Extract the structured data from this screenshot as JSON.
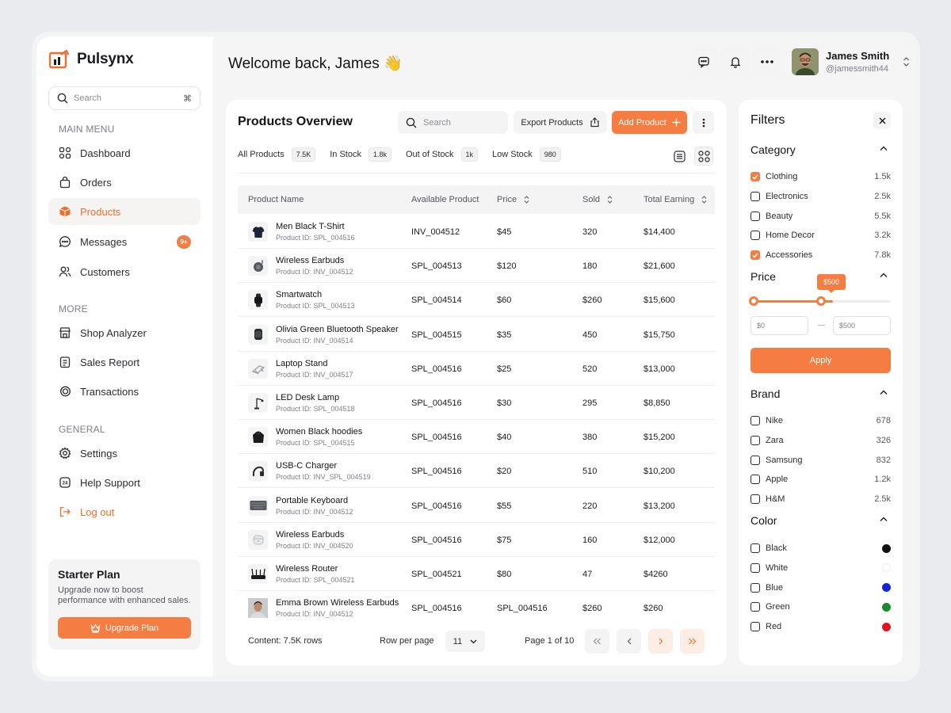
{
  "brand": {
    "name": "Pulsynx"
  },
  "sidebar": {
    "search_placeholder": "Search",
    "search_shortcut": "⌘",
    "main_menu_title": "MAIN MENU",
    "main_items": [
      {
        "label": "Dashboard",
        "icon": "dashboard-icon"
      },
      {
        "label": "Orders",
        "icon": "bag-icon"
      },
      {
        "label": "Products",
        "icon": "box-icon",
        "active": true
      },
      {
        "label": "Messages",
        "icon": "chat-icon",
        "badge": "9+"
      },
      {
        "label": "Customers",
        "icon": "users-icon"
      }
    ],
    "more_title": "MORE",
    "more_items": [
      {
        "label": "Shop Analyzer",
        "icon": "shop-icon"
      },
      {
        "label": "Sales Report",
        "icon": "report-icon"
      },
      {
        "label": "Transactions",
        "icon": "coins-icon"
      }
    ],
    "general_title": "GENERAL",
    "general_items": [
      {
        "label": "Settings",
        "icon": "gear-icon"
      },
      {
        "label": "Help Support",
        "icon": "support-icon"
      },
      {
        "label": "Log out",
        "icon": "logout-icon"
      }
    ],
    "plan": {
      "title": "Starter Plan",
      "description": "Upgrade now to boost performance with enhanced sales.",
      "button": "Upgrade Plan"
    }
  },
  "header": {
    "welcome": "Welcome back, James 👋",
    "user": {
      "name": "James Smith",
      "handle": "@jamessmith44"
    }
  },
  "products": {
    "title": "Products Overview",
    "search_placeholder": "Search",
    "export_label": "Export Products",
    "add_label": "Add Product",
    "tabs": [
      {
        "label": "All Products",
        "count": "7.5K"
      },
      {
        "label": "In Stock",
        "count": "1.8k"
      },
      {
        "label": "Out of Stock",
        "count": "1k"
      },
      {
        "label": "Low Stock",
        "count": "980"
      }
    ],
    "columns": [
      "Product Name",
      "Available Product",
      "Price",
      "Sold",
      "Total Earning"
    ],
    "rows": [
      {
        "name": "Men Black T-Shirt",
        "pid": "Product ID: SPL_004516",
        "available": "INV_004512",
        "price": "$45",
        "sold": "320",
        "earning": "$14,400",
        "thumb": "tshirt"
      },
      {
        "name": "Wireless Earbuds",
        "pid": "Product ID: INV_004512",
        "available": "SPL_004513",
        "price": "$120",
        "sold": "180",
        "earning": "$21,600",
        "thumb": "earbuds-round"
      },
      {
        "name": "Smartwatch",
        "pid": "Product ID: SPL_004513",
        "available": "SPL_004514",
        "price": "$60",
        "sold": "$260",
        "earning": "$15,600",
        "thumb": "watch"
      },
      {
        "name": "Olivia Green Bluetooth Speaker",
        "pid": "Product ID: INV_004514",
        "available": "SPL_004515",
        "price": "$35",
        "sold": "450",
        "earning": "$15,750",
        "thumb": "speaker"
      },
      {
        "name": "Laptop Stand",
        "pid": "Product ID: INV_004517",
        "available": "SPL_004516",
        "price": "$25",
        "sold": "520",
        "earning": "$13,000",
        "thumb": "stand"
      },
      {
        "name": "LED Desk Lamp",
        "pid": "Product ID: SPL_004518",
        "available": "SPL_004516",
        "price": "$30",
        "sold": "295",
        "earning": "$8,850",
        "thumb": "lamp"
      },
      {
        "name": "Women Black hoodies",
        "pid": "Product ID: SPL_004515",
        "available": "SPL_004516",
        "price": "$40",
        "sold": "380",
        "earning": "$15,200",
        "thumb": "hoodie"
      },
      {
        "name": "USB-C Charger",
        "pid": "Product ID: INV_SPL_004519",
        "available": "SPL_004516",
        "price": "$20",
        "sold": "510",
        "earning": "$10,200",
        "thumb": "charger"
      },
      {
        "name": "Portable Keyboard",
        "pid": "Product ID: INV_004512",
        "available": "SPL_004516",
        "price": "$55",
        "sold": "220",
        "earning": "$13,200",
        "thumb": "keyboard"
      },
      {
        "name": "Wireless Earbuds",
        "pid": "Product ID: INV_004520",
        "available": "SPL_004516",
        "price": "$75",
        "sold": "160",
        "earning": "$12,000",
        "thumb": "earbuds-case"
      },
      {
        "name": "Wireless Router",
        "pid": "Product ID: SPL_004521",
        "available": "SPL_004521",
        "price": "$80",
        "sold": "47",
        "earning": "$4260",
        "thumb": "router"
      },
      {
        "name": "Emma Brown Wireless Earbuds",
        "pid": "Product ID: INV_004512",
        "available": "SPL_004516",
        "price": "SPL_004516",
        "sold": "$260",
        "earning": "$260",
        "thumb": "person"
      }
    ],
    "footer": {
      "content": "Content: 7.5K rows",
      "rows_per_page_label": "Row per page",
      "rows_per_page_value": "11",
      "page_info": "Page 1 of 10"
    }
  },
  "filters": {
    "title": "Filters",
    "category_title": "Category",
    "categories": [
      {
        "label": "Clothing",
        "count": "1.5k",
        "checked": true
      },
      {
        "label": "Electronics",
        "count": "2.5k",
        "checked": false
      },
      {
        "label": "Beauty",
        "count": "5.5k",
        "checked": false
      },
      {
        "label": "Home Decor",
        "count": "3.2k",
        "checked": false
      },
      {
        "label": "Accessories",
        "count": "7.8k",
        "checked": true
      }
    ],
    "price_title": "Price",
    "price_tooltip": "$500",
    "price_min_placeholder": "$0",
    "price_max_placeholder": "$500",
    "apply_label": "Apply",
    "brand_title": "Brand",
    "brands": [
      {
        "label": "Nike",
        "count": "678"
      },
      {
        "label": "Zara",
        "count": "326"
      },
      {
        "label": "Samsung",
        "count": "832"
      },
      {
        "label": "Apple",
        "count": "1.2k"
      },
      {
        "label": "H&M",
        "count": "2.5k"
      }
    ],
    "color_title": "Color",
    "colors": [
      {
        "label": "Black",
        "swatch": "#111111"
      },
      {
        "label": "White",
        "swatch": "#ffffff"
      },
      {
        "label": "Blue",
        "swatch": "#1524d6"
      },
      {
        "label": "Green",
        "swatch": "#1a8a2a"
      },
      {
        "label": "Red",
        "swatch": "#e3141c"
      }
    ]
  },
  "theme": {
    "accent": "#f57d42"
  }
}
